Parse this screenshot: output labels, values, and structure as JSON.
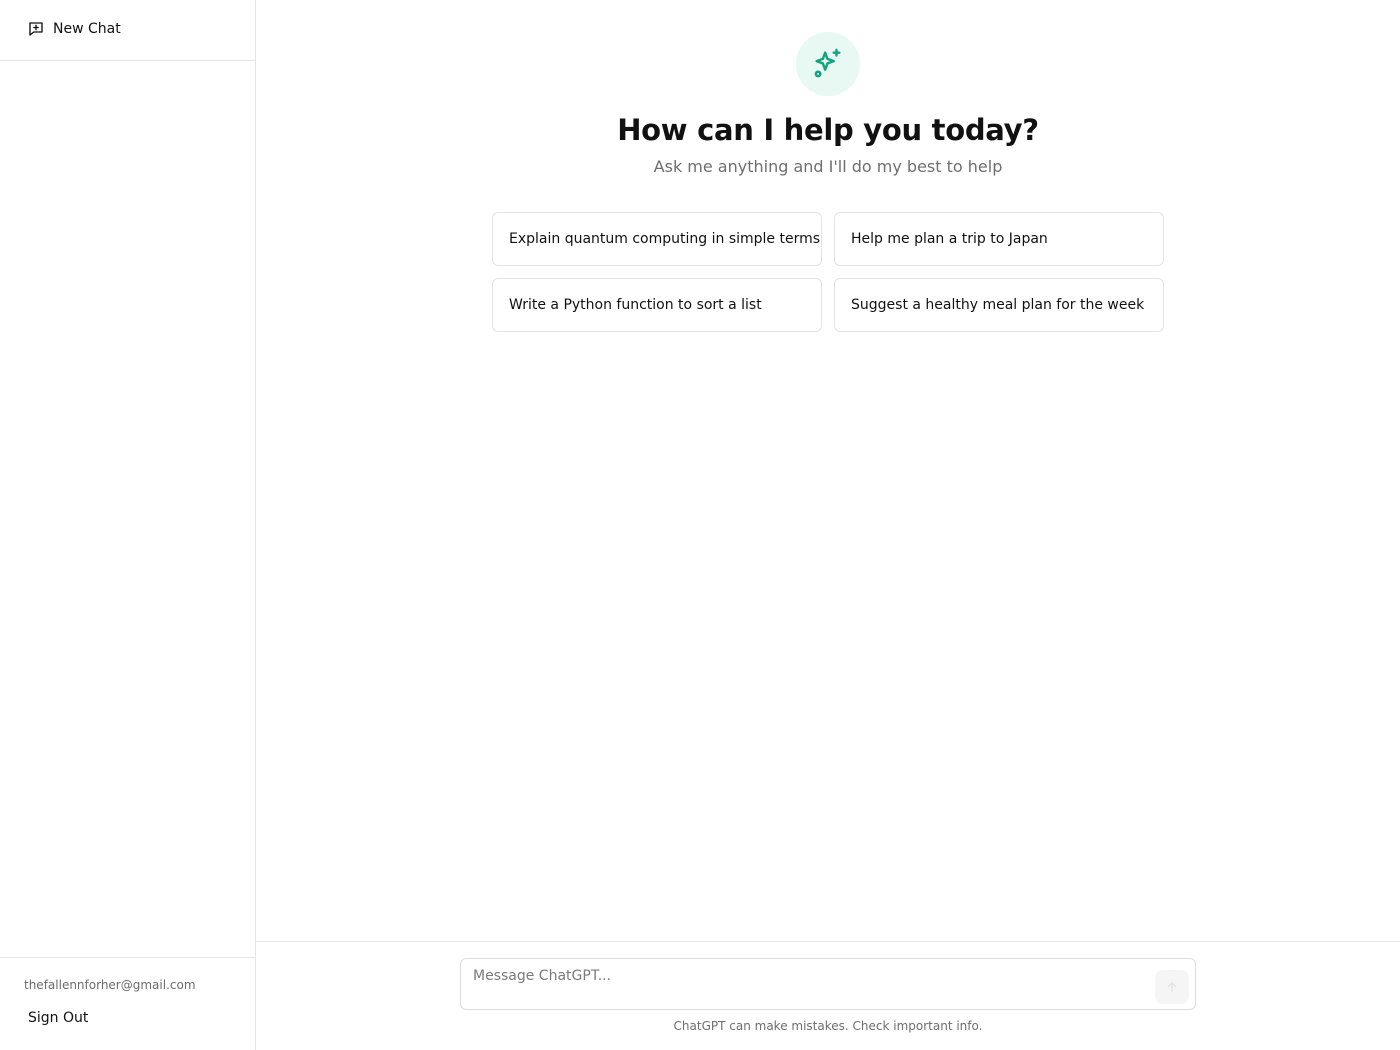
{
  "sidebar": {
    "new_chat_label": "New Chat",
    "new_chat_icon": "message-plus-icon",
    "user_email": "thefallennforher@gmail.com",
    "sign_out_label": "Sign Out"
  },
  "hero": {
    "icon": "sparkles-icon",
    "title": "How can I help you today?",
    "subtitle": "Ask me anything and I'll do my best to help"
  },
  "suggestions": [
    "Explain quantum computing in simple terms",
    "Help me plan a trip to Japan",
    "Write a Python function to sort a list",
    "Suggest a healthy meal plan for the week"
  ],
  "composer": {
    "placeholder": "Message ChatGPT...",
    "value": "",
    "send_icon": "arrow-up-icon",
    "disclaimer": "ChatGPT can make mistakes. Check important info."
  },
  "colors": {
    "accent": "#10a37f",
    "accent_bg": "#e8f8f2",
    "border": "#e5e5e5"
  }
}
